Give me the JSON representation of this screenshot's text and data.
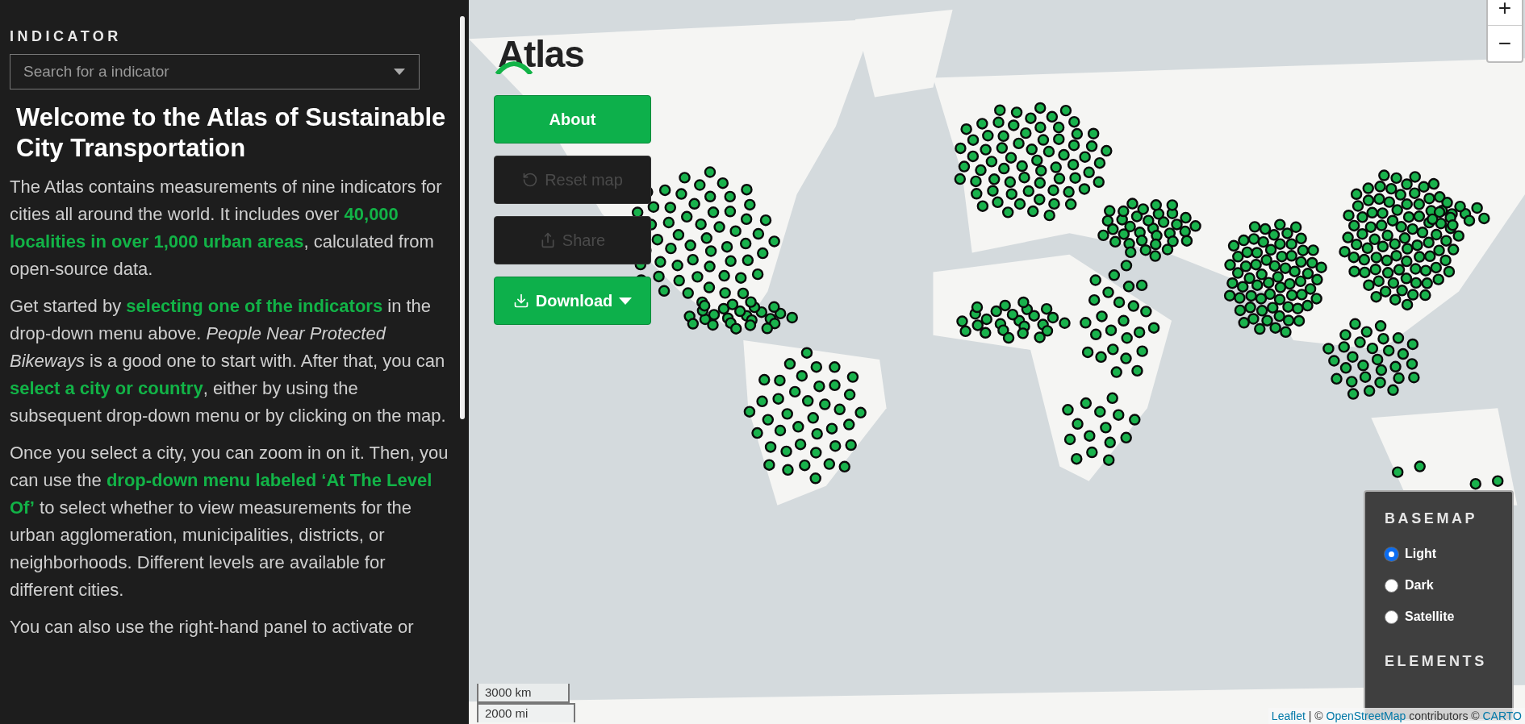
{
  "sidebar": {
    "label": "INDICATOR",
    "search": {
      "placeholder": "Search for a indicator"
    },
    "heading": "Welcome to the Atlas of Sustainable City Transportation",
    "paragraphs": [
      "The Atlas contains measurements of nine indicators for cities all around the world. It includes over **40,000 localities in over 1,000 urban areas**, calculated from open-source data.",
      "Get started by **selecting one of the indicators** in the drop-down menu above. *People Near Protected Bikeways* is a good one to start with. After that, you can **select a city or country**, either by using the subsequent drop-down menu or by clicking on the map.",
      "Once you select a city, you can zoom in on it. Then, you can use the **drop-down menu labeled ‘At The Level Of’** to select whether to view measurements for the urban agglomeration, municipalities, districts, or neighborhoods. Different levels are available for different cities.",
      "You can also use the right-hand panel to activate or"
    ]
  },
  "map": {
    "logo": "Atlas",
    "buttons": [
      {
        "label": "About",
        "kind": "about",
        "disabled": false,
        "dropdown": false
      },
      {
        "label": "Reset map",
        "kind": "reset",
        "disabled": true,
        "dropdown": false
      },
      {
        "label": "Share",
        "kind": "share",
        "disabled": true,
        "dropdown": false
      },
      {
        "label": "Download",
        "kind": "download",
        "disabled": false,
        "dropdown": true
      }
    ],
    "zoom": [
      "+",
      "−"
    ],
    "basemap": {
      "title": "BASEMAP",
      "options": [
        {
          "label": "Light",
          "selected": true
        },
        {
          "label": "Dark",
          "selected": false
        },
        {
          "label": "Satellite",
          "selected": false
        }
      ]
    },
    "elements_title": "ELEMENTS",
    "scale": [
      "3000 km",
      "2000 mi"
    ],
    "attribution": [
      {
        "kind": "link",
        "text": "Leaflet"
      },
      {
        "kind": "text",
        "text": " | © "
      },
      {
        "kind": "link",
        "text": "OpenStreetMap"
      },
      {
        "kind": "text",
        "text": " contributors © "
      },
      {
        "kind": "link",
        "text": "CARTO"
      }
    ]
  }
}
